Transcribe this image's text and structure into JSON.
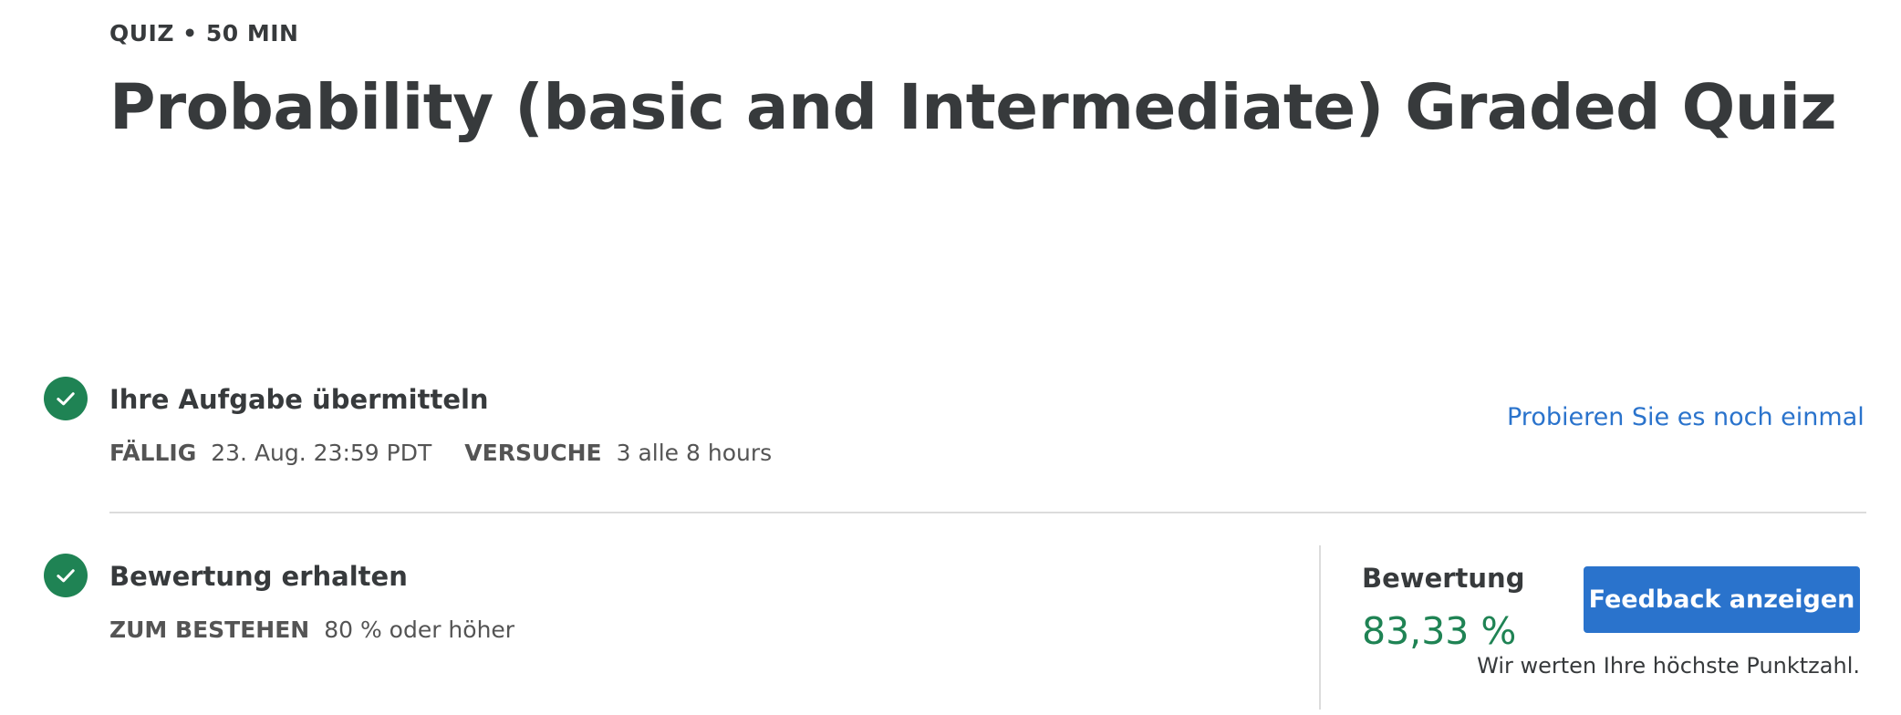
{
  "header": {
    "eyebrow": "QUIZ • 50 MIN",
    "title": "Probability (basic and Intermediate) Graded Quiz"
  },
  "submit_step": {
    "title": "Ihre Aufgabe übermitteln",
    "due_label": "FÄLLIG",
    "due_value": "23. Aug. 23:59 PDT",
    "attempts_label": "VERSUCHE",
    "attempts_value": "3 alle 8 hours",
    "retry_link": "Probieren Sie es noch einmal",
    "icon": "check-circle-icon"
  },
  "grade_step": {
    "title": "Bewertung erhalten",
    "pass_label": "ZUM BESTEHEN",
    "pass_value": "80 % oder höher",
    "icon": "check-circle-icon"
  },
  "grade_panel": {
    "label": "Bewertung",
    "value": "83,33 %",
    "feedback_button": "Feedback anzeigen",
    "note": "Wir werten Ihre höchste Punktzahl."
  },
  "colors": {
    "success": "#1f8354",
    "link": "#2a73cc",
    "button_bg": "#2a73cc",
    "text": "#373a3c"
  }
}
